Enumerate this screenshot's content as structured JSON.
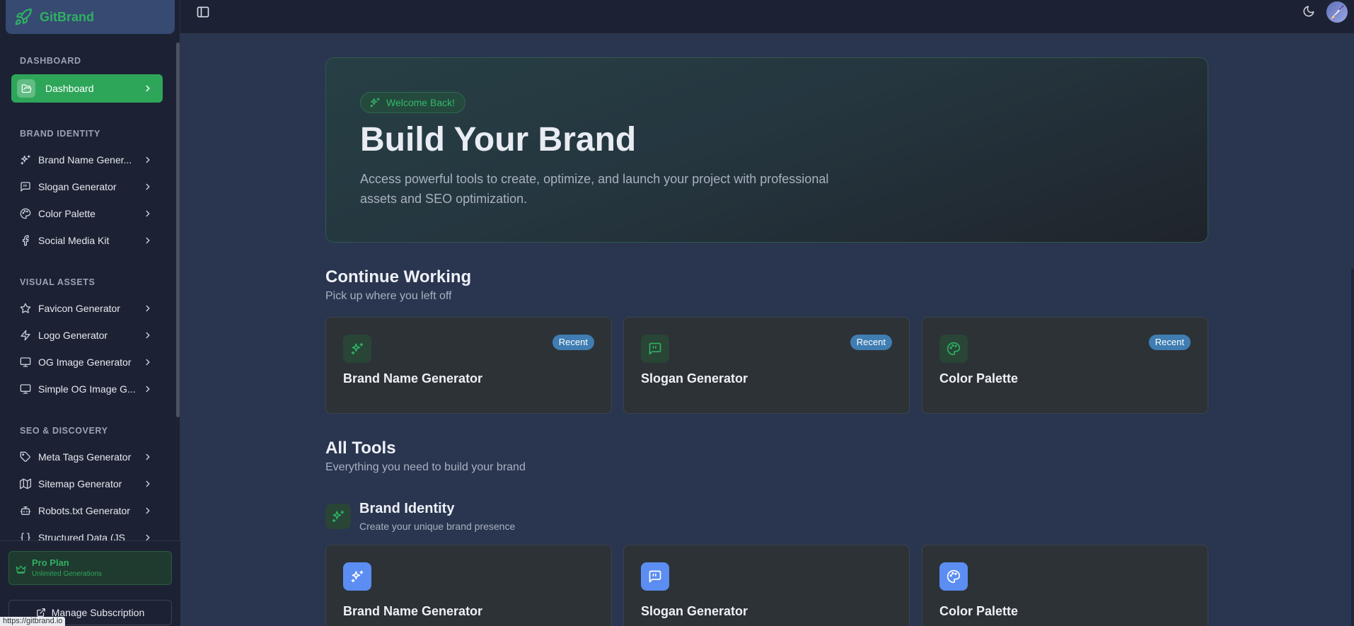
{
  "app": {
    "name": "GitBrand"
  },
  "sidebar": {
    "sections": [
      {
        "label": "DASHBOARD"
      },
      {
        "label": "BRAND IDENTITY"
      },
      {
        "label": "VISUAL ASSETS"
      },
      {
        "label": "SEO & DISCOVERY"
      }
    ],
    "items": [
      {
        "label": "Dashboard",
        "icon": "folder-open-icon",
        "active": true
      },
      {
        "label": "Brand Name Gener...",
        "icon": "sparkles-icon"
      },
      {
        "label": "Slogan Generator",
        "icon": "quote-message-icon"
      },
      {
        "label": "Color Palette",
        "icon": "palette-icon"
      },
      {
        "label": "Social Media Kit",
        "icon": "facebook-icon"
      },
      {
        "label": "Favicon Generator",
        "icon": "star-icon"
      },
      {
        "label": "Logo Generator",
        "icon": "lightning-icon"
      },
      {
        "label": "OG Image Generator",
        "icon": "monitor-icon"
      },
      {
        "label": "Simple OG Image G...",
        "icon": "monitor-icon"
      },
      {
        "label": "Meta Tags Generator",
        "icon": "tag-icon"
      },
      {
        "label": "Sitemap Generator",
        "icon": "map-icon"
      },
      {
        "label": "Robots.txt Generator",
        "icon": "robot-icon"
      },
      {
        "label": "Structured Data (JS",
        "icon": "braces-icon"
      }
    ],
    "plan": {
      "title": "Pro Plan",
      "subtitle": "Unlimited Generations"
    },
    "manage_label": "Manage Subscription",
    "status_url": "https://gitbrand.io"
  },
  "hero": {
    "pill": "Welcome Back!",
    "title": "Build Your Brand",
    "description": "Access powerful tools to create, optimize, and launch your project with professional assets and SEO optimization."
  },
  "continue": {
    "title": "Continue Working",
    "subtitle": "Pick up where you left off",
    "cards": [
      {
        "title": "Brand Name Generator",
        "badge": "Recent",
        "icon": "sparkles-icon"
      },
      {
        "title": "Slogan Generator",
        "badge": "Recent",
        "icon": "quote-message-icon"
      },
      {
        "title": "Color Palette",
        "badge": "Recent",
        "icon": "palette-icon"
      }
    ]
  },
  "all_tools": {
    "title": "All Tools",
    "subtitle": "Everything you need to build your brand",
    "category": {
      "title": "Brand Identity",
      "subtitle": "Create your unique brand presence"
    },
    "cards": [
      {
        "title": "Brand Name Generator",
        "icon": "sparkles-icon"
      },
      {
        "title": "Slogan Generator",
        "icon": "quote-message-icon"
      },
      {
        "title": "Color Palette",
        "icon": "palette-icon"
      }
    ]
  },
  "colors": {
    "accent": "#2ea65a",
    "badge": "#3f7db2",
    "tool_icon": "#5b8df2",
    "sidebar_bg": "#1c2234",
    "main_bg": "#2a3550"
  }
}
